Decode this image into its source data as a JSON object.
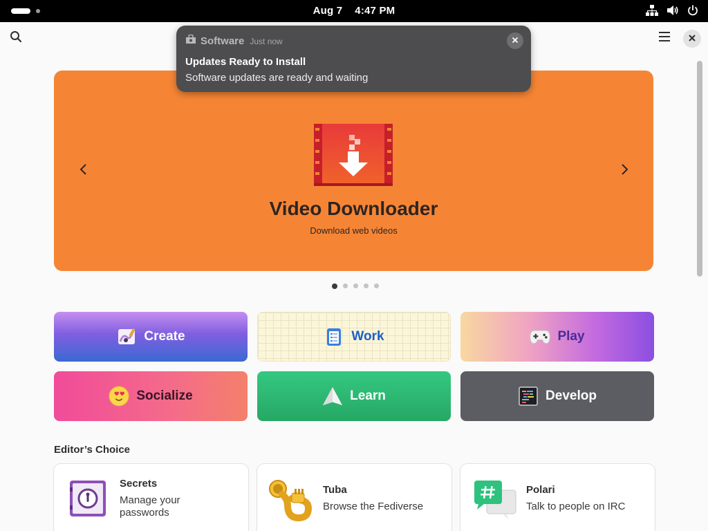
{
  "system": {
    "date": "Aug 7",
    "time": "4:47 PM"
  },
  "header": {
    "search_icon": "search-icon",
    "menu_icon": "hamburger-menu-icon",
    "close_icon": "close-icon"
  },
  "notification": {
    "app": "Software",
    "time": "Just now",
    "title": "Updates Ready to Install",
    "body": "Software updates are ready and waiting"
  },
  "banner": {
    "title": "Video Downloader",
    "subtitle": "Download web videos",
    "color": "#f58535",
    "page": 1,
    "pages": 5
  },
  "categories": [
    {
      "label": "Create"
    },
    {
      "label": "Work"
    },
    {
      "label": "Play"
    },
    {
      "label": "Socialize"
    },
    {
      "label": "Learn"
    },
    {
      "label": "Develop"
    }
  ],
  "editors_choice": {
    "title": "Editor’s Choice",
    "apps": [
      {
        "name": "Secrets",
        "desc": "Manage your passwords"
      },
      {
        "name": "Tuba",
        "desc": "Browse the Fediverse"
      },
      {
        "name": "Polari",
        "desc": "Talk to people on IRC"
      }
    ]
  }
}
